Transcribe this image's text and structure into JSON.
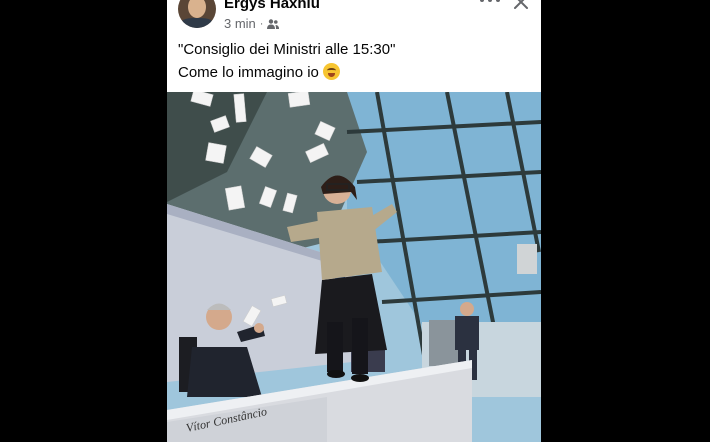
{
  "post": {
    "author": "Ergys Haxhiu",
    "time": "3 min",
    "separator": "·",
    "audience_icon": "friends-icon",
    "line1": "\"Consiglio dei Ministri alle 15:30\"",
    "line2": "Come lo immagino io",
    "emoji": "rolling-on-floor-laughing-emoji"
  },
  "photo": {
    "nameplate": "Vítor Constâncio"
  },
  "colors": {
    "background": "#000000",
    "card": "#ffffff",
    "author_text": "#050505",
    "meta_text": "#65676b"
  }
}
